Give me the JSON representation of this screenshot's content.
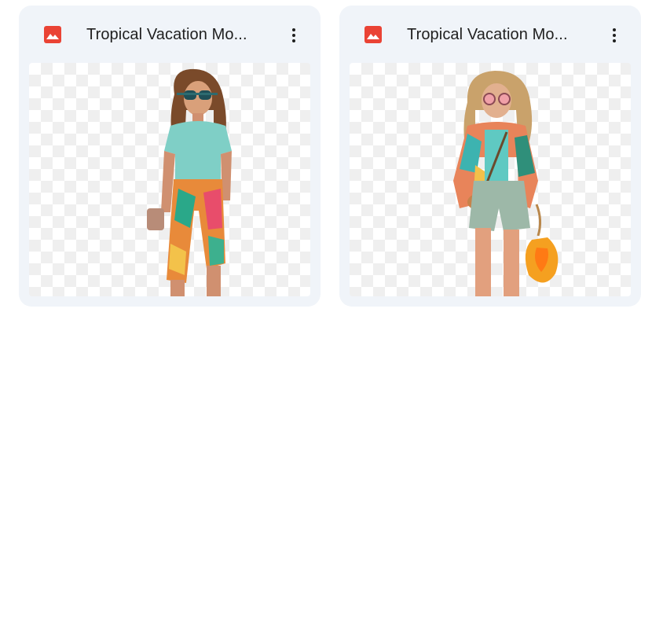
{
  "files": [
    {
      "title": "Tropical Vacation Mo...",
      "file_type_icon": "image-file-icon",
      "menu_icon": "more-vert-icon"
    },
    {
      "title": "Tropical Vacation Mo...",
      "file_type_icon": "image-file-icon",
      "menu_icon": "more-vert-icon"
    }
  ],
  "colors": {
    "card_background": "#f0f4f9",
    "image_icon": "#ea4335",
    "title_text": "#1f1f1f",
    "checker": "#efefef"
  }
}
